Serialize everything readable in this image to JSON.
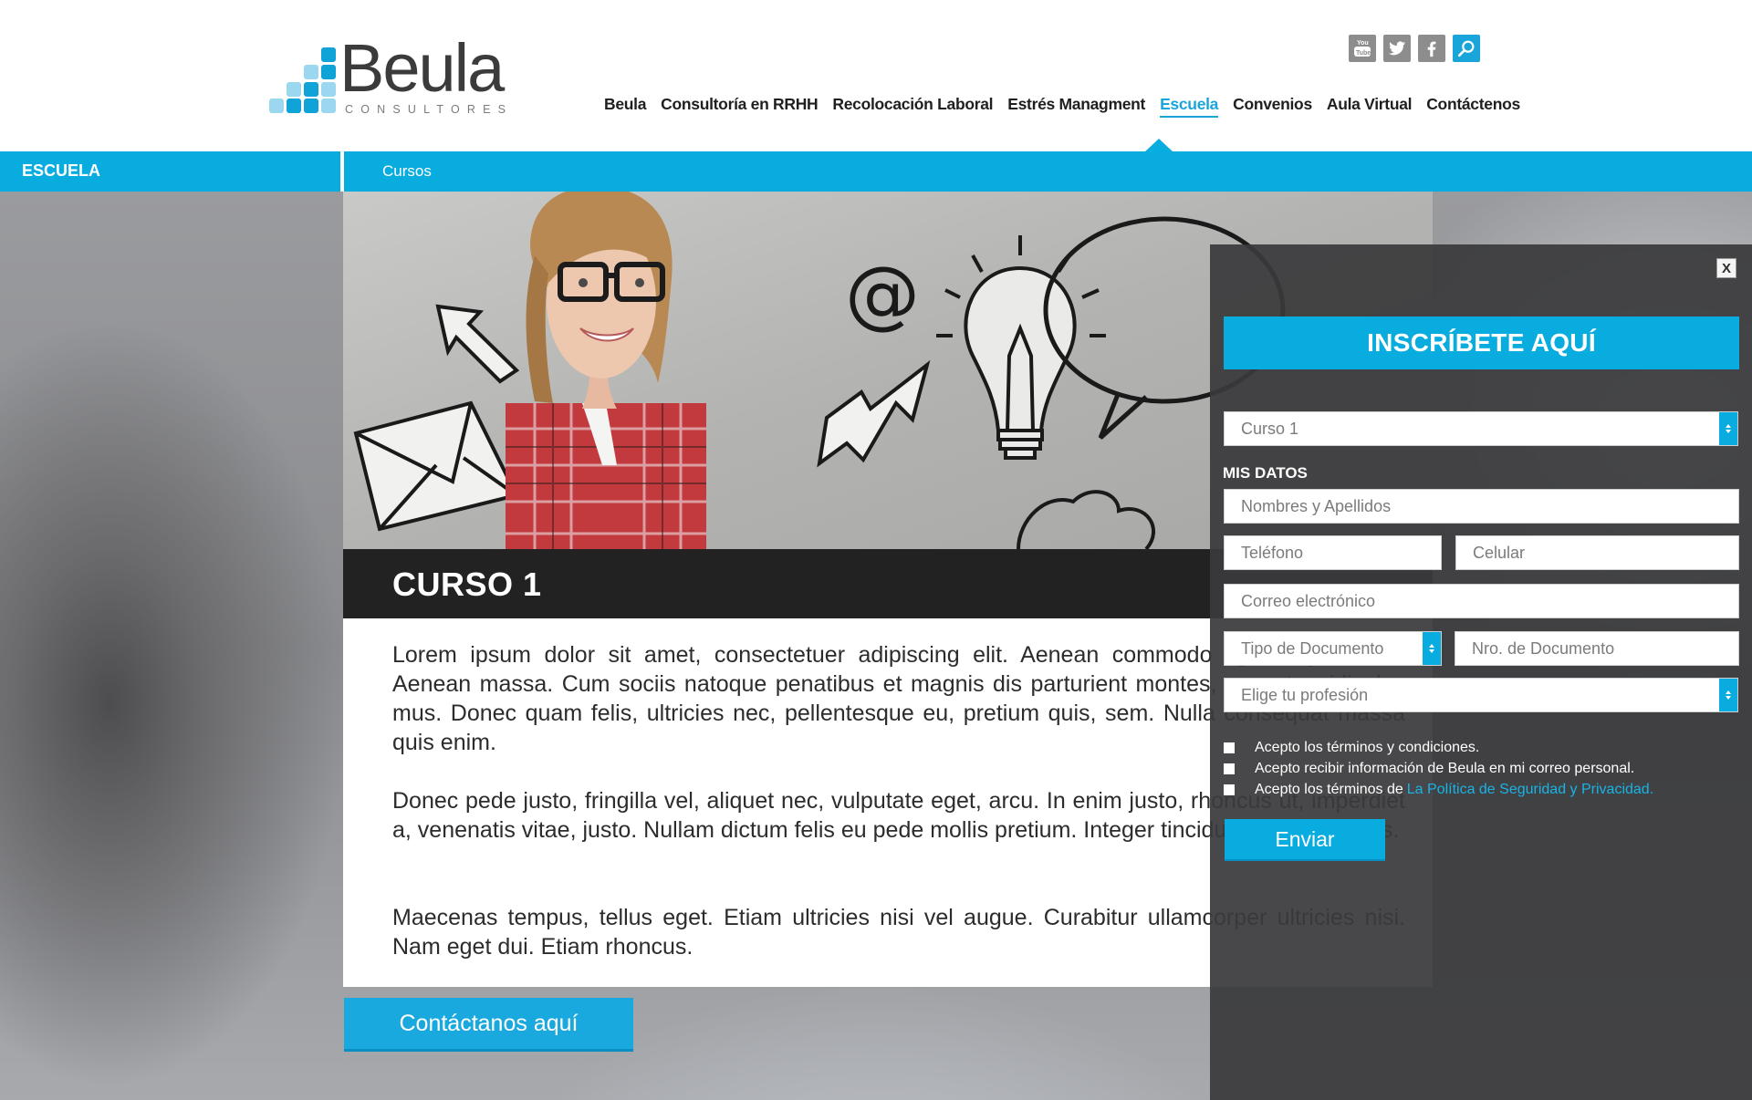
{
  "brand": {
    "name": "Beula",
    "tagline": "CONSULTORES"
  },
  "social": [
    "youtube-icon",
    "twitter-icon",
    "facebook-icon",
    "search-icon"
  ],
  "nav": {
    "items": [
      {
        "label": "Beula"
      },
      {
        "label": "Consultoría en RRHH"
      },
      {
        "label": "Recolocación Laboral"
      },
      {
        "label": "Estrés Managment"
      },
      {
        "label": "Escuela",
        "active": true
      },
      {
        "label": "Convenios"
      },
      {
        "label": "Aula Virtual"
      },
      {
        "label": "Contáctenos"
      }
    ]
  },
  "section_bar": {
    "section": "ESCUELA",
    "breadcrumb": "Cursos"
  },
  "course": {
    "title": "CURSO 1",
    "paragraphs": [
      "Lorem ipsum dolor sit amet, consectetuer adipiscing elit. Aenean commodo ligula eget dolor. Aenean massa. Cum sociis natoque penatibus et magnis dis parturient montes, nascetur ridiculus mus. Donec quam felis, ultricies nec, pellentesque eu, pretium quis, sem. Nulla consequat massa quis enim.",
      "Donec pede justo, fringilla vel, aliquet nec, vulputate eget, arcu. In enim justo, rhoncus ut, imperdiet a, venenatis vitae, justo. Nullam dictum felis eu pede mollis pretium. Integer tincidunt. Cras dapibus.",
      "Maecenas tempus, tellus eget. Etiam ultricies nisi vel augue. Curabitur ullamcorper ultricies nisi. Nam eget dui. Etiam rhoncus."
    ],
    "contact_button": "Contáctanos aquí"
  },
  "form": {
    "close": "X",
    "title": "INSCRÍBETE AQUÍ",
    "course_select": "Curso 1",
    "section_label": "MIS DATOS",
    "fields": {
      "names": "Nombres y Apellidos",
      "phone": "Teléfono",
      "mobile": "Celular",
      "email": "Correo electrónico",
      "doc_type": "Tipo de Documento",
      "doc_number": "Nro. de Documento",
      "profession": "Elige tu profesión"
    },
    "checks": [
      {
        "text": "Acepto los términos y condiciones."
      },
      {
        "text": "Acepto recibir información de Beula en mi correo personal."
      },
      {
        "text": "Acepto los términos de",
        "link": "La Política de Seguridad y Privacidad."
      }
    ],
    "submit": "Enviar"
  },
  "colors": {
    "accent": "#08acdf",
    "dark": "#222223",
    "overlay": "#3a3a3c"
  }
}
